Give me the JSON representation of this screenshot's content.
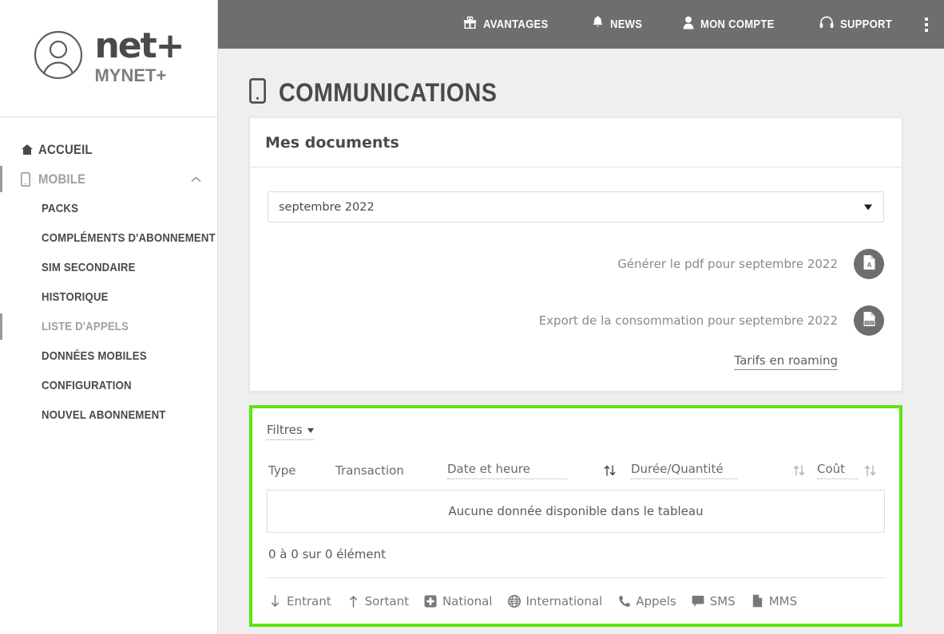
{
  "brand": {
    "avatar_icon": "user-avatar-icon",
    "name": "net+",
    "subtitle": "MYNET+"
  },
  "topbar": {
    "items": [
      {
        "label": "AVANTAGES",
        "icon": "gift-icon"
      },
      {
        "label": "NEWS",
        "icon": "bell-icon"
      },
      {
        "label": "MON COMPTE",
        "icon": "person-icon"
      },
      {
        "label": "SUPPORT",
        "icon": "headset-icon"
      }
    ],
    "menu_icon": "kebab-menu-icon"
  },
  "sidebar": {
    "items": [
      {
        "label": "ACCUEIL",
        "icon": "home-icon",
        "active": false,
        "dim": false
      },
      {
        "label": "MOBILE",
        "icon": "mobile-icon",
        "active": true,
        "dim": true,
        "chevron": "chevron-up-icon"
      }
    ],
    "sub_items": [
      {
        "label": "PACKS",
        "dim": false,
        "active": false
      },
      {
        "label": "COMPLÉMENTS D'ABONNEMENT",
        "dim": false,
        "active": false
      },
      {
        "label": "SIM SECONDAIRE",
        "dim": false,
        "active": false
      },
      {
        "label": "HISTORIQUE",
        "dim": false,
        "active": false
      },
      {
        "label": "LISTE D'APPELS",
        "dim": true,
        "active": true
      },
      {
        "label": "DONNÉES MOBILES",
        "dim": false,
        "active": false
      },
      {
        "label": "CONFIGURATION",
        "dim": false,
        "active": false
      },
      {
        "label": "NOUVEL ABONNEMENT",
        "dim": false,
        "active": false
      }
    ]
  },
  "page": {
    "title": "COMMUNICATIONS",
    "title_icon": "mobile-icon"
  },
  "documents_card": {
    "header": "Mes documents",
    "month_select": {
      "value": "septembre 2022",
      "caret_icon": "caret-down-icon"
    },
    "rows": [
      {
        "label": "Générer le pdf pour septembre 2022",
        "icon": "pdf-file-icon"
      },
      {
        "label": "Export de la consommation pour septembre 2022",
        "icon": "csv-file-icon"
      }
    ],
    "roaming_link": "Tarifs en roaming"
  },
  "table_card": {
    "highlight_color": "#5ce611",
    "filters_label": "Filtres",
    "filters_icon": "chevron-down-icon",
    "columns": [
      {
        "label": "Type",
        "sortable": false,
        "sort_icon": null,
        "sort_active": false
      },
      {
        "label": "Transaction",
        "sortable": false,
        "sort_icon": null,
        "sort_active": false
      },
      {
        "label": "Date et heure",
        "sortable": true,
        "sort_icon": "sort-updown-icon",
        "sort_active": true
      },
      {
        "label": "Durée/Quantité",
        "sortable": true,
        "sort_icon": "sort-updown-icon",
        "sort_active": false
      },
      {
        "label": "Coût",
        "sortable": true,
        "sort_icon": "sort-updown-icon",
        "sort_active": false
      }
    ],
    "empty_message": "Aucune donnée disponible dans le tableau",
    "count_text": "0 à 0 sur 0 élément",
    "legend": [
      {
        "label": "Entrant",
        "icon": "arrow-down-icon"
      },
      {
        "label": "Sortant",
        "icon": "arrow-up-icon"
      },
      {
        "label": "National",
        "icon": "swiss-cross-icon"
      },
      {
        "label": "International",
        "icon": "globe-icon"
      },
      {
        "label": "Appels",
        "icon": "phone-icon"
      },
      {
        "label": "SMS",
        "icon": "speech-bubble-icon"
      },
      {
        "label": "MMS",
        "icon": "document-icon"
      }
    ]
  }
}
